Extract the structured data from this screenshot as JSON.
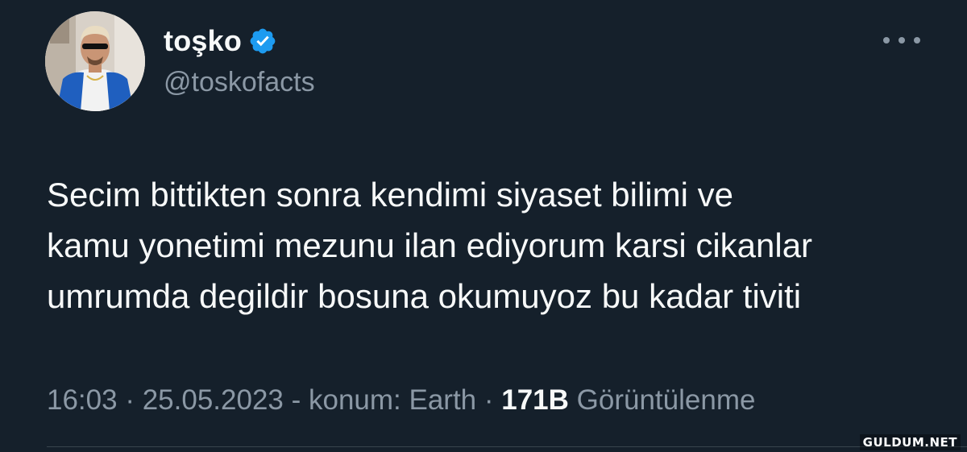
{
  "author": {
    "display_name": "toşko",
    "handle": "@toskofacts",
    "verified": true
  },
  "tweet": {
    "text_lines": [
      "Secim bittikten sonra kendimi siyaset bilimi ve",
      "kamu yonetimi mezunu ilan ediyorum karsi cikanlar",
      "umrumda degildir bosuna okumuyoz bu kadar tiviti"
    ]
  },
  "meta": {
    "time": "16:03",
    "separator": " · ",
    "date": "25.05.2023",
    "location_sep": " - ",
    "location": "konum: Earth",
    "views_count": "171B",
    "views_label": " Görüntülenme"
  },
  "icons": {
    "verified": "verified-badge-icon",
    "more": "more-horizontal-icon"
  },
  "colors": {
    "background": "#15202b",
    "verified_blue": "#1d9bf0",
    "secondary_text": "#8b98a5",
    "primary_text": "#f7f9f9"
  },
  "watermark": "GULDUM.NET"
}
